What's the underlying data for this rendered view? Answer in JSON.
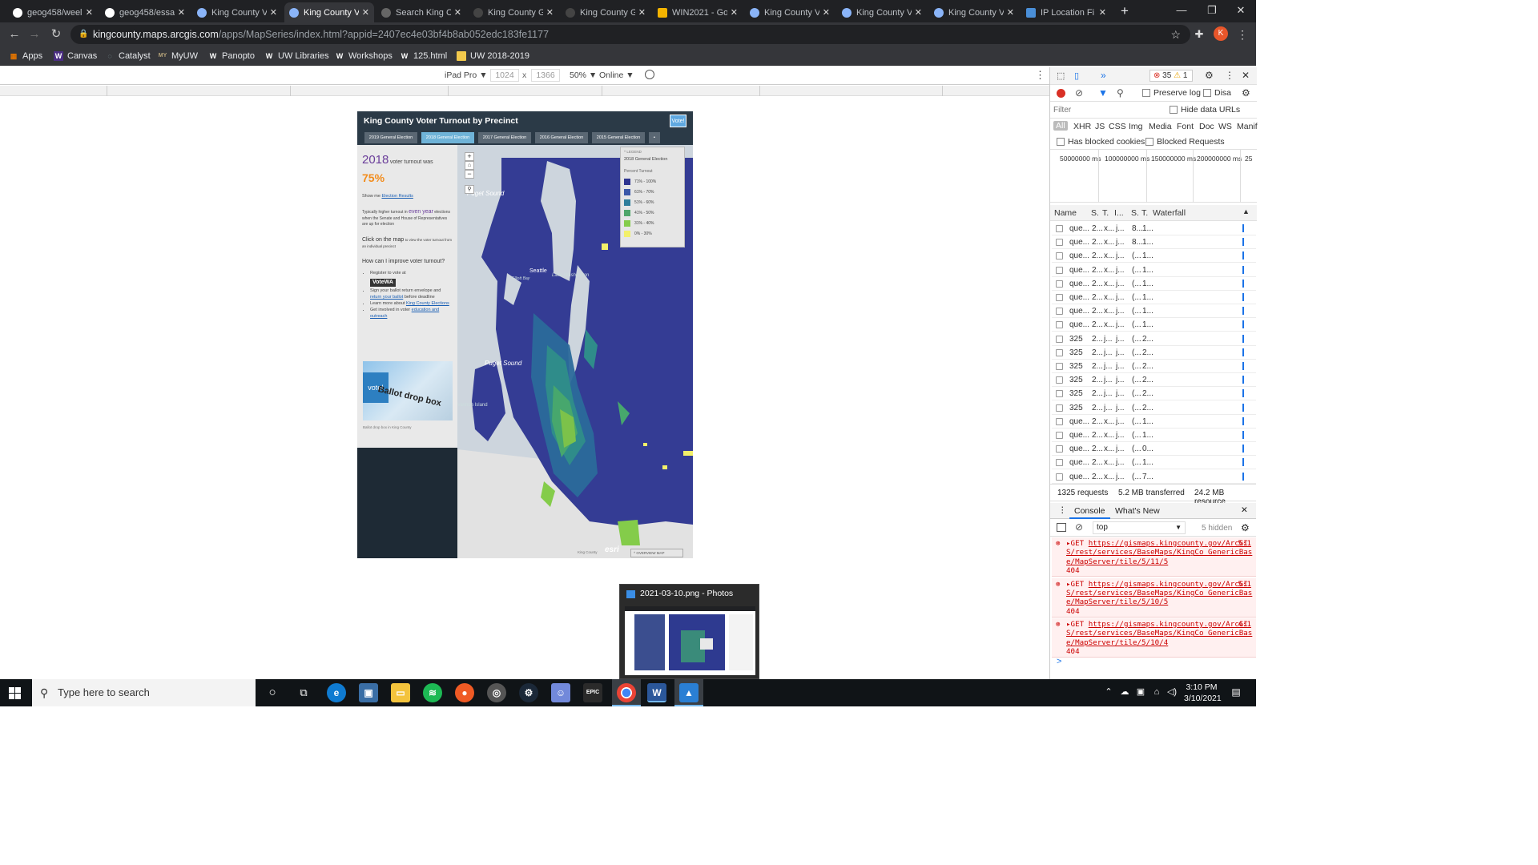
{
  "browser": {
    "tabs": [
      {
        "label": "geog458/weel",
        "active": false
      },
      {
        "label": "geog458/essa",
        "active": false
      },
      {
        "label": "King County V",
        "active": false
      },
      {
        "label": "King County V",
        "active": true
      },
      {
        "label": "Search King C",
        "active": false
      },
      {
        "label": "King County G",
        "active": false
      },
      {
        "label": "King County G",
        "active": false
      },
      {
        "label": "WIN2021 - Go",
        "active": false
      },
      {
        "label": "King County V",
        "active": false
      },
      {
        "label": "King County V",
        "active": false
      },
      {
        "label": "King County V",
        "active": false
      },
      {
        "label": "IP Location Fi",
        "active": false
      }
    ],
    "new_tab": "+",
    "window_controls": {
      "minimize": "—",
      "restore": "❐",
      "close": "✕"
    },
    "url_host": "kingcounty.maps.arcgis.com",
    "url_path": "/apps/MapSeries/index.html?appid=2407ec4e03bf4b8ab052edc183fe1177",
    "profile_initial": "K",
    "bookmarks": [
      {
        "label": "Apps",
        "icon": "apps-grid-icon"
      },
      {
        "label": "Canvas",
        "icon": "W"
      },
      {
        "label": "Catalyst",
        "icon": "catalyst-icon"
      },
      {
        "label": "MyUW",
        "icon": "MY"
      },
      {
        "label": "Panopto",
        "icon": "W"
      },
      {
        "label": "UW Libraries",
        "icon": "W"
      },
      {
        "label": "Workshops",
        "icon": "W"
      },
      {
        "label": "125.html",
        "icon": "W"
      },
      {
        "label": "UW 2018-2019",
        "icon": "folder-icon"
      }
    ]
  },
  "device_toolbar": {
    "device": "iPad Pro ▼",
    "width": "1024",
    "height": "1366",
    "zoom": "50% ▼",
    "network": "Online ▼",
    "times": "x"
  },
  "app": {
    "title": "King County Voter Turnout by Precinct",
    "badge": "Vote!",
    "tabs": [
      "2019 General Election",
      "2018 General Election",
      "2017 General Election",
      "2016 General Election",
      "2015 General Election"
    ],
    "active_tab_index": 1,
    "panel": {
      "year": "2018",
      "turnout_intro": "voter turnout was",
      "turnout_value": "75%",
      "show_me": "Show me",
      "show_me_link": "Election Results",
      "typically_prefix": "Typically higher turnout in",
      "even_year": "even year",
      "typically_suffix": "elections when the Senate and House of Representatives are up for election",
      "click_heading": "Click on the map",
      "click_body": "to view the voter turnout from an individual precinct",
      "improve_heading": "How can I improve voter turnout?",
      "bullets": [
        {
          "text": "Register to vote at",
          "link": ""
        },
        {
          "text": "Sign your ballot return envelope and",
          "link": "return your ballot",
          "tail": "before deadline"
        },
        {
          "text": "Learn more about",
          "link": "King County Elections",
          "tail": ""
        },
        {
          "text": "Get involved in voter",
          "link": "education and outreach",
          "tail": ""
        }
      ],
      "votewa_logo": "VoteWA",
      "photo_text": "Ballot drop box",
      "photo_caption": "Ballot drop box in King County"
    },
    "map_labels": [
      "Puget Sound",
      "Puget Sound",
      "Seattle",
      "Elliott Bay",
      "Lake Washington",
      "Vashon Island"
    ],
    "legend": {
      "header": "LEGEND",
      "title": "2018 General Election",
      "subtitle": "Percent Turnout",
      "items": [
        {
          "label": "71% - 100%",
          "color": "#2e3590"
        },
        {
          "label": "61% - 70%",
          "color": "#3b58a8"
        },
        {
          "label": "51% - 60%",
          "color": "#2f7e9b"
        },
        {
          "label": "41% - 50%",
          "color": "#4fa66a"
        },
        {
          "label": "31% - 40%",
          "color": "#84cc4a"
        },
        {
          "label": "0% - 30%",
          "color": "#f2f06a"
        }
      ]
    },
    "attribution": "King County",
    "esri": "esri",
    "overview": "OVERVIEW MAP"
  },
  "devtools": {
    "errors": "35",
    "warnings": "1",
    "preserve_log": "Preserve log",
    "disable": "Disa",
    "filter_placeholder": "Filter",
    "hide_data_urls": "Hide data URLs",
    "type_filters": [
      "All",
      "XHR",
      "JS",
      "CSS",
      "Img",
      "Media",
      "Font",
      "Doc",
      "WS",
      "Manif"
    ],
    "has_blocked_cookies": "Has blocked cookies",
    "blocked_requests": "Blocked Requests",
    "timeline": [
      "50000000 ms",
      "100000000 ms",
      "150000000 ms",
      "200000000 ms",
      "25"
    ],
    "columns": [
      "Name",
      "S.",
      "T.",
      "I...",
      "S.",
      "T.",
      "Waterfall"
    ],
    "requests": [
      [
        "que...",
        "2...",
        "x...",
        "j...",
        "8...",
        "1..."
      ],
      [
        "que...",
        "2...",
        "x...",
        "j...",
        "8...",
        "1..."
      ],
      [
        "que...",
        "2...",
        "x...",
        "j...",
        "(...",
        "1..."
      ],
      [
        "que...",
        "2...",
        "x...",
        "j...",
        "(...",
        "1..."
      ],
      [
        "que...",
        "2...",
        "x...",
        "j...",
        "(...",
        "1..."
      ],
      [
        "que...",
        "2...",
        "x...",
        "j...",
        "(...",
        "1..."
      ],
      [
        "que...",
        "2...",
        "x...",
        "j...",
        "(...",
        "1..."
      ],
      [
        "que...",
        "2...",
        "x...",
        "j...",
        "(...",
        "1..."
      ],
      [
        "325",
        "2...",
        "j...",
        "j...",
        "(...",
        "2..."
      ],
      [
        "325",
        "2...",
        "j...",
        "j...",
        "(...",
        "2..."
      ],
      [
        "325",
        "2...",
        "j...",
        "j...",
        "(...",
        "2..."
      ],
      [
        "325",
        "2...",
        "j...",
        "j...",
        "(...",
        "2..."
      ],
      [
        "325",
        "2...",
        "j...",
        "j...",
        "(...",
        "2..."
      ],
      [
        "325",
        "2...",
        "j...",
        "j...",
        "(...",
        "2..."
      ],
      [
        "que...",
        "2...",
        "x...",
        "j...",
        "(...",
        "1..."
      ],
      [
        "que...",
        "2...",
        "x...",
        "j...",
        "(...",
        "1..."
      ],
      [
        "que...",
        "2...",
        "x...",
        "j...",
        "(...",
        "0..."
      ],
      [
        "que...",
        "2...",
        "x...",
        "j...",
        "(...",
        "1..."
      ],
      [
        "que...",
        "2...",
        "x...",
        "j...",
        "(...",
        "7..."
      ]
    ],
    "summary_requests": "1325 requests",
    "summary_transferred": "5.2 MB transferred",
    "summary_resources": "24.2 MB resource",
    "drawer_tabs": [
      "Console",
      "What's New"
    ],
    "context": "top",
    "hidden": "5 hidden",
    "console_errors": [
      {
        "method": "GET",
        "url": "https://gismaps.kingcounty.gov/ArcGIS/rest/services/BaseMaps/KingCo_GenericBase/MapServer/tile/5/11/5",
        "line": "5:1",
        "status": "404"
      },
      {
        "method": "GET",
        "url": "https://gismaps.kingcounty.gov/ArcGIS/rest/services/BaseMaps/KingCo_GenericBase/MapServer/tile/5/10/5",
        "line": "5:1",
        "status": "404"
      },
      {
        "method": "GET",
        "url": "https://gismaps.kingcounty.gov/ArcGIS/rest/services/BaseMaps/KingCo_GenericBase/MapServer/tile/5/10/4",
        "line": "4:1",
        "status": "404"
      }
    ],
    "prompt": ">"
  },
  "photos_preview": {
    "title": "2021-03-10.png - Photos"
  },
  "taskbar": {
    "search_placeholder": "Type here to search",
    "time": "3:10 PM",
    "date": "3/10/2021"
  }
}
